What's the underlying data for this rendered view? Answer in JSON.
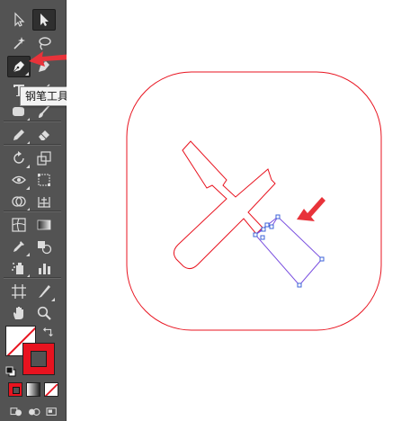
{
  "tooltip": {
    "text": "钢笔工具 (P)"
  },
  "colors": {
    "toolbar_bg": "#535353",
    "active_tool_bg": "#2f2f2f",
    "stroke_color": "#e8131f",
    "path_color": "#e8131f",
    "selection_color": "#6c3fd6",
    "annotation_arrow": "#e8333a"
  },
  "tools": [
    "selection-tool",
    "direct-selection-tool",
    "magic-wand-tool",
    "lasso-tool",
    "pen-tool",
    "curvature-tool",
    "type-tool",
    "line-segment-tool",
    "rectangle-tool",
    "paintbrush-tool",
    "pencil-tool",
    "eraser-tool",
    "rotate-tool",
    "scale-tool",
    "width-tool",
    "free-transform-tool",
    "shape-builder-tool",
    "graph-tool",
    "mesh-tool",
    "gradient-tool",
    "eyedropper-tool",
    "blend-tool",
    "symbol-sprayer-tool",
    "column-graph-tool",
    "artboard-tool",
    "slice-tool",
    "hand-tool",
    "zoom-tool"
  ],
  "active_tool": "pen-tool"
}
